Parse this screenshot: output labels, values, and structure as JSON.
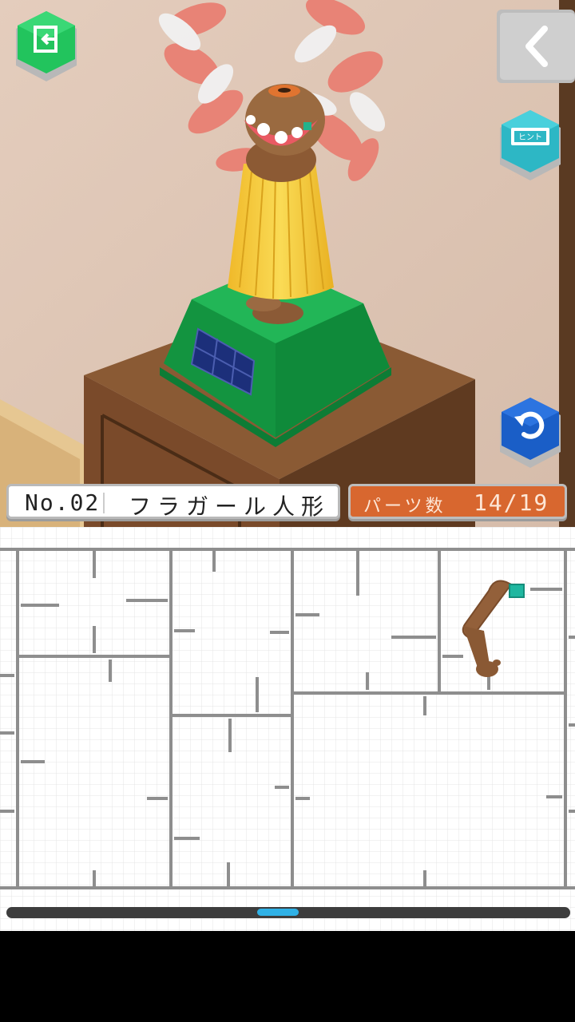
{
  "header": {
    "number_label": "No.02",
    "item_name": "フラガール人形",
    "parts_label": "パーツ数",
    "parts_count": "14/19"
  },
  "buttons": {
    "exit_icon": "exit-door-icon",
    "back_icon": "chevron-left-icon",
    "hint_label": "ヒント",
    "undo_icon": "undo-arrow-icon"
  },
  "colors": {
    "wall": "#dcc3b2",
    "pedestal_green": "#1aa64c",
    "skirt_yellow": "#f5c838",
    "lei_pink": "#ef7f72",
    "parts_orange": "#d8672f",
    "scroll_thumb": "#2fb1e6"
  },
  "scroll": {
    "position": 0.48
  }
}
